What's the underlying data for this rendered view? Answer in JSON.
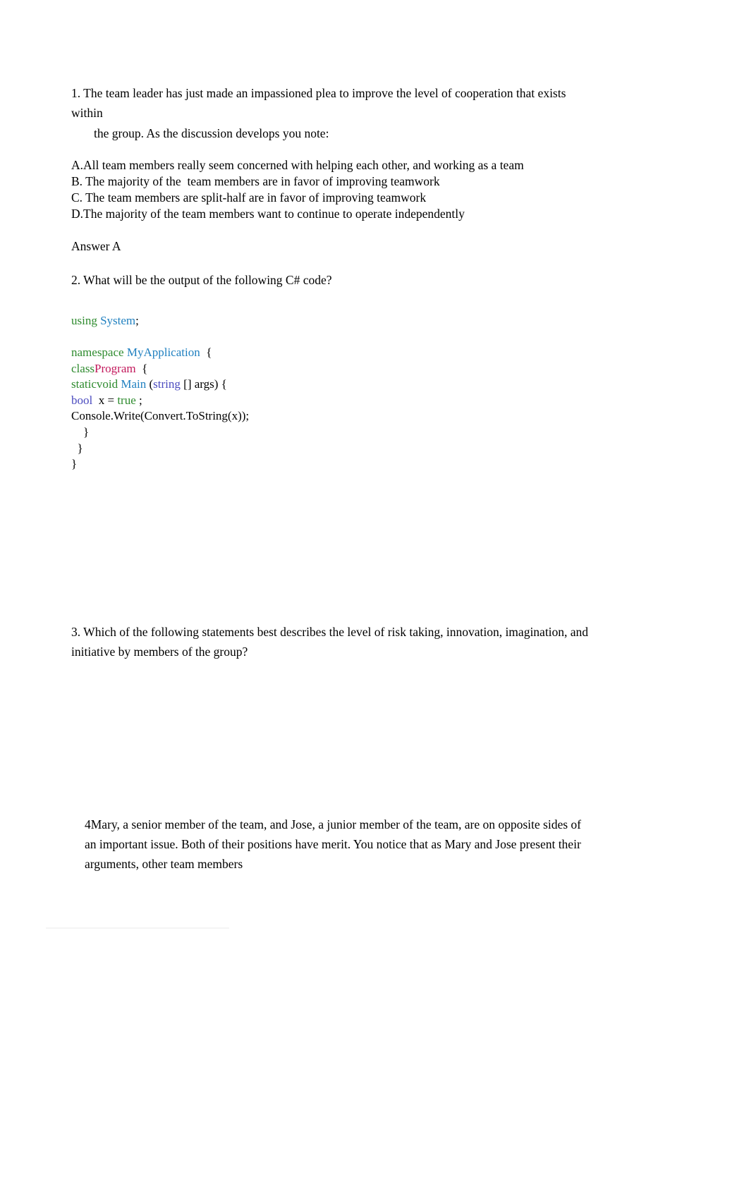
{
  "document": {
    "questions": [
      {
        "number": "1.",
        "prompt_line_1": "1. The team leader has just made an impassioned plea to improve the level of cooperation that exists within",
        "prompt_line_2": "the group. As the discussion develops you note:",
        "options": [
          "A.All team members really seem concerned with helping each other, and working as a team",
          "B. The majority of the  team members are in favor of improving teamwork",
          "C. The team members are split-half are in favor of improving teamwork",
          "D.The majority of the team members want to continue to operate independently"
        ],
        "answer": "Answer A"
      },
      {
        "number": "2.",
        "prompt": "2. What will be the output of the following C# code?",
        "code": {
          "language": "csharp",
          "lines": [
            [
              {
                "t": "using ",
                "c": "kw"
              },
              {
                "t": "System",
                "c": "type"
              },
              {
                "t": ";",
                "c": "plain"
              }
            ],
            [],
            [
              {
                "t": "namespace ",
                "c": "kw"
              },
              {
                "t": "MyApplication",
                "c": "type"
              },
              {
                "t": "  {",
                "c": "plain"
              }
            ],
            [
              {
                "t": "class",
                "c": "kw"
              },
              {
                "t": "Program",
                "c": "class"
              },
              {
                "t": "  {",
                "c": "plain"
              }
            ],
            [
              {
                "t": "staticvoid ",
                "c": "kw"
              },
              {
                "t": "Main ",
                "c": "type"
              },
              {
                "t": "(",
                "c": "plain"
              },
              {
                "t": "string ",
                "c": "prim"
              },
              {
                "t": "[] args) {",
                "c": "plain"
              }
            ],
            [
              {
                "t": "bool ",
                "c": "prim"
              },
              {
                "t": " x = ",
                "c": "plain"
              },
              {
                "t": "true ",
                "c": "kw"
              },
              {
                "t": ";",
                "c": "plain"
              }
            ],
            [
              {
                "t": "Console.Write(Convert.ToString(x));",
                "c": "plain"
              }
            ],
            [
              {
                "t": "    }",
                "c": "plain"
              }
            ],
            [
              {
                "t": "  }",
                "c": "plain"
              }
            ],
            [
              {
                "t": "}",
                "c": "plain"
              }
            ]
          ]
        }
      },
      {
        "number": "3.",
        "prompt_line_1": "3. Which of the following statements best describes the level of risk taking, innovation, imagination, and",
        "prompt_line_2": "initiative by members of the group?"
      },
      {
        "number": "4",
        "prompt": "4Mary, a senior member of the team, and Jose, a junior member of the team, are on opposite sides of an important issue. Both of their positions have merit. You notice that as Mary and Jose present their arguments, other team members"
      }
    ]
  }
}
